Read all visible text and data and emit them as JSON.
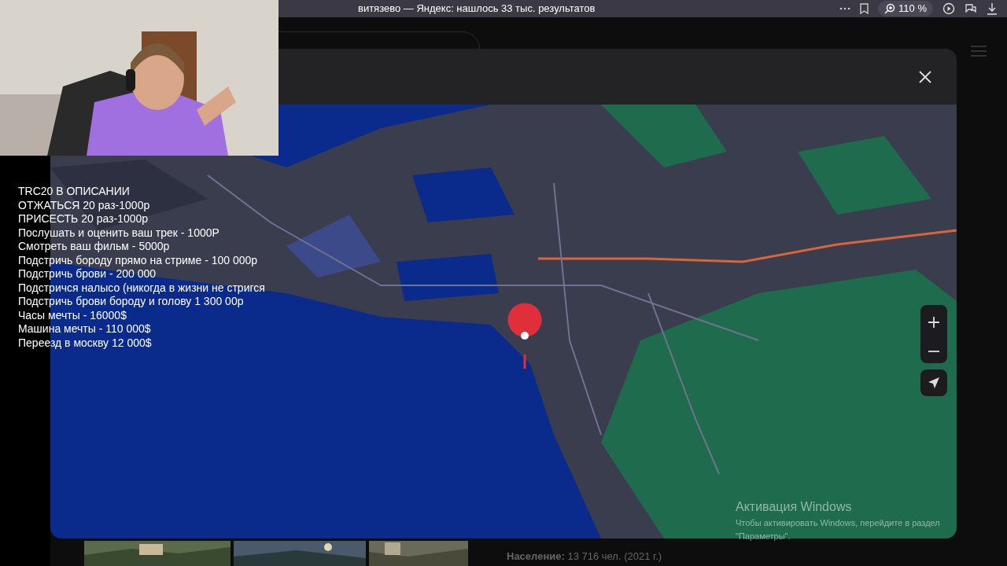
{
  "browser": {
    "title": "витязево — Яндекс: нашлось 33 тыс. результатов",
    "zoom": "110 %"
  },
  "stream_overlay": {
    "lines": [
      "TRC20 В ОПИСАНИИ",
      "ОТЖАТЬСЯ 20 раз-1000р",
      "ПРИСЕСТЬ 20 раз-1000р",
      "Послушать и оценить ваш трек - 1000Р",
      "Смотреть ваш фильм - 5000р",
      "Подстричь бороду прямо на стриме - 100 000р",
      "Подстричь брови - 200 000",
      "Подстричся налысо (никогда в жизни не стригся",
      "Подстричь брови бороду и голову 1 300 00р",
      "Часы мечты - 16000$",
      "Машина мечты - 110 000$",
      "Переезд в москву 12 000$"
    ]
  },
  "page": {
    "population": "**Население:** 13 716 чел. (2021 г.)"
  },
  "os_notice": {
    "title": "Активация Windows",
    "text": "Чтобы активировать Windows, перейдите в раздел",
    "text2": "\"Параметры\"."
  }
}
